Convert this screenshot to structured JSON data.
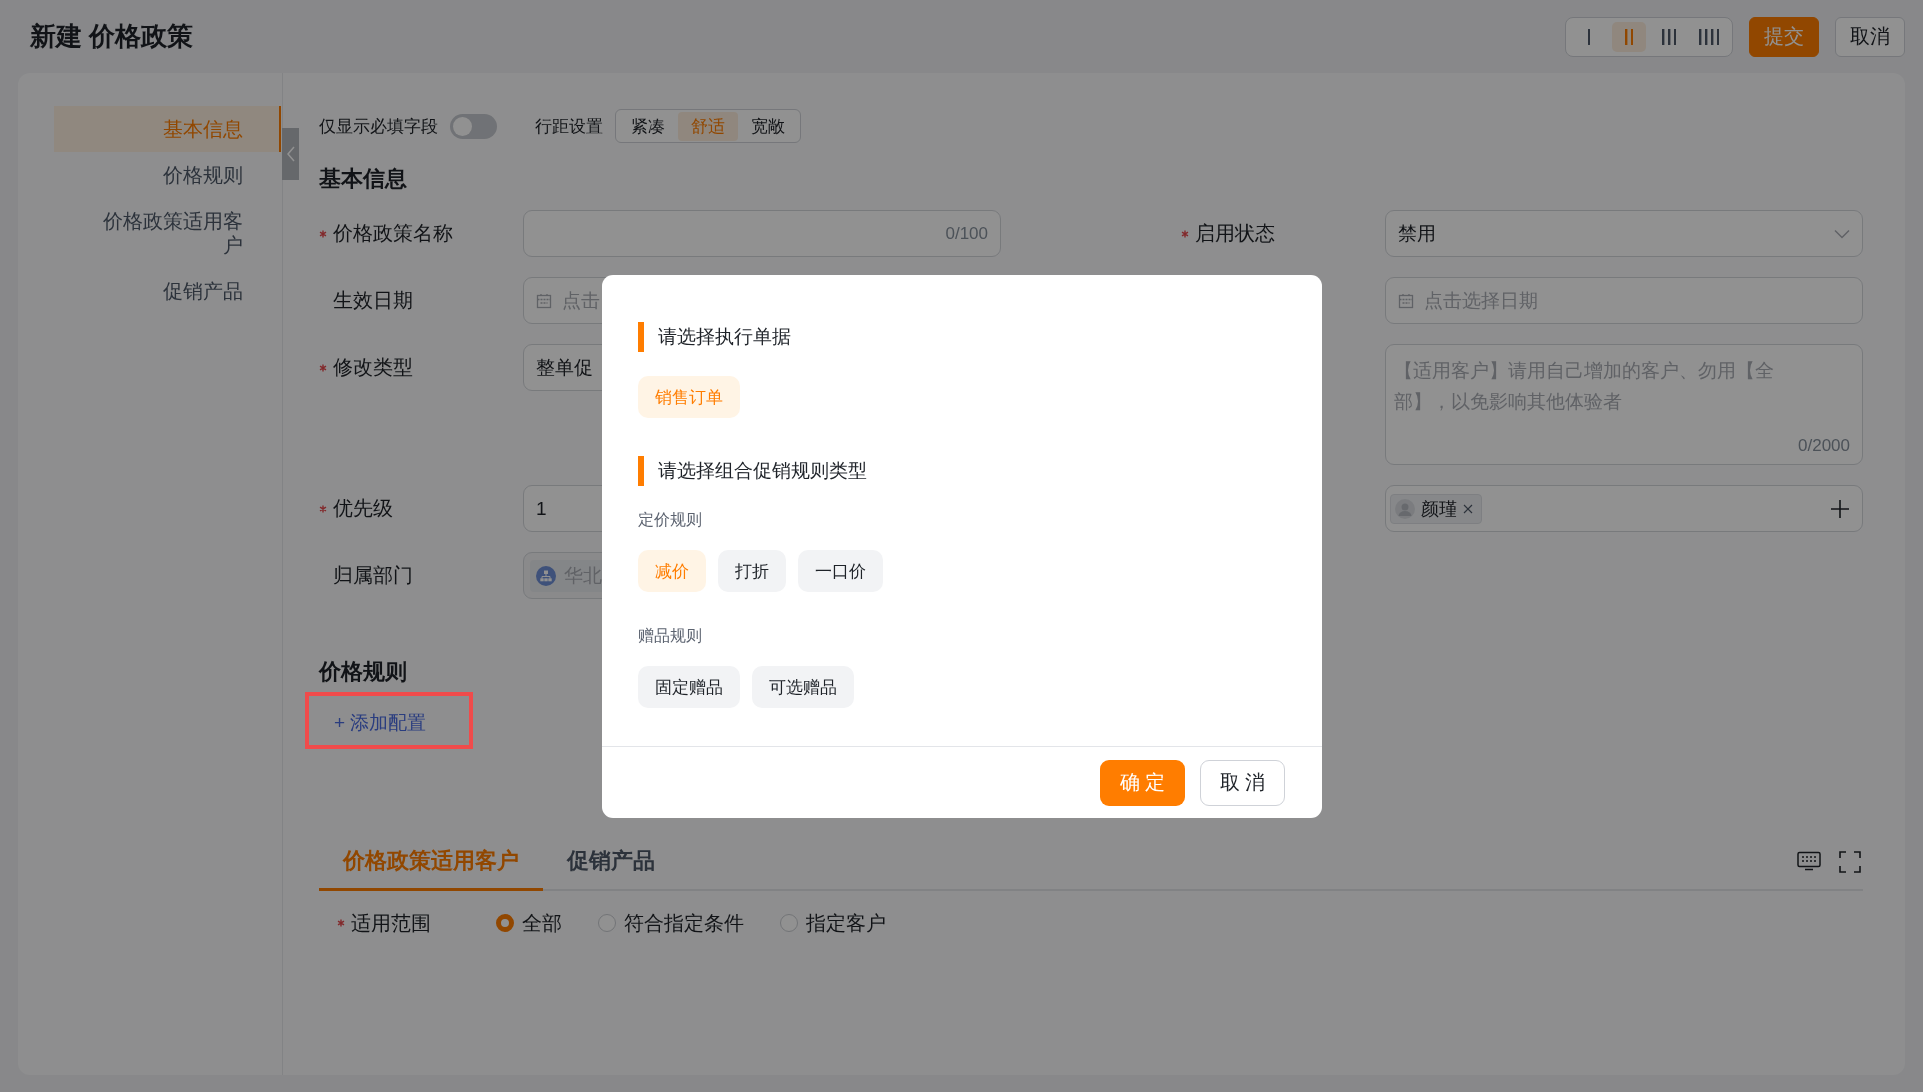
{
  "header": {
    "title": "新建 价格政策",
    "layouts": [
      {
        "selected": false
      },
      {
        "selected": true
      },
      {
        "selected": false
      },
      {
        "selected": false
      }
    ],
    "actions": [
      {
        "label": "提交",
        "kind": "primary"
      },
      {
        "label": "取消",
        "kind": "default"
      }
    ]
  },
  "nav": [
    {
      "label": "基本信息",
      "selected": true
    },
    {
      "label": "价格规则",
      "selected": false
    },
    {
      "label": "价格政策适用客户",
      "selected": false
    },
    {
      "label": "促销产品",
      "selected": false
    }
  ],
  "toolbar": {
    "required_only": {
      "label": "仅显示必填字段",
      "on": false
    },
    "spacing": {
      "label": "行距设置",
      "options": [
        {
          "label": "紧凑",
          "selected": false
        },
        {
          "label": "舒适",
          "selected": true
        },
        {
          "label": "宽敞",
          "selected": false
        }
      ]
    }
  },
  "basic_info": {
    "heading": "基本信息",
    "rows": [
      {
        "left": {
          "label": "价格政策名称",
          "required": true,
          "kind": "text",
          "counter": "0/100"
        },
        "right": {
          "label": "启用状态",
          "required": true,
          "kind": "select",
          "value": "禁用"
        }
      },
      {
        "left": {
          "label": "生效日期",
          "required": false,
          "kind": "date",
          "placeholder": "点击"
        },
        "right": {
          "kind": "date",
          "placeholder": "点击选择日期"
        }
      },
      {
        "left": {
          "label": "修改类型",
          "required": true,
          "kind": "text",
          "value": "整单促"
        },
        "right": {
          "kind": "textarea",
          "placeholder": "【适用客户】请用自己增加的客户、勿用【全部】，以免影响其他体验者",
          "counter": "0/2000"
        }
      },
      {
        "left": {
          "label": "优先级",
          "required": true,
          "kind": "text",
          "value": "1"
        },
        "right": {
          "kind": "members",
          "tags": [
            {
              "label": "颜瑾"
            }
          ]
        }
      },
      {
        "left": {
          "label": "归属部门",
          "required": false,
          "kind": "department",
          "disabled": true,
          "value": "华北"
        }
      }
    ]
  },
  "pricing_rules": {
    "heading": "价格规则",
    "add_link": "+ 添加配置",
    "highlighted": true
  },
  "bottom": {
    "tabs": [
      {
        "label": "价格政策适用客户",
        "selected": true
      },
      {
        "label": "促销产品",
        "selected": false
      }
    ],
    "scope": {
      "label": "适用范围",
      "required": true,
      "options": [
        {
          "label": "全部",
          "selected": true
        },
        {
          "label": "符合指定条件",
          "selected": false
        },
        {
          "label": "指定客户",
          "selected": false
        }
      ]
    }
  },
  "dialog": {
    "sections": [
      {
        "title": "请选择执行单据",
        "groups": [
          {
            "chips": [
              {
                "label": "销售订单",
                "selected": true
              }
            ]
          }
        ]
      },
      {
        "title": "请选择组合促销规则类型",
        "groups": [
          {
            "label": "定价规则",
            "chips": [
              {
                "label": "减价",
                "selected": true
              },
              {
                "label": "打折",
                "selected": false
              },
              {
                "label": "一口价",
                "selected": false
              }
            ]
          },
          {
            "label": "赠品规则",
            "chips": [
              {
                "label": "固定赠品",
                "selected": false
              },
              {
                "label": "可选赠品",
                "selected": false
              }
            ]
          }
        ]
      }
    ],
    "buttons": [
      {
        "label": "确 定",
        "kind": "primary"
      },
      {
        "label": "取 消",
        "kind": "default"
      }
    ]
  }
}
